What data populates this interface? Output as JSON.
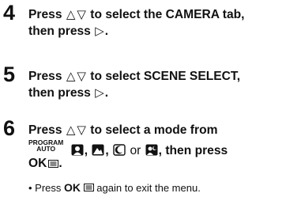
{
  "step4": {
    "number": "4",
    "line1_a": "Press",
    "line1_b": "to select the CAMERA tab,",
    "line2_a": "then press",
    "line2_b": "."
  },
  "step5": {
    "number": "5",
    "line1_a": "Press",
    "line1_b": "to select SCENE SELECT,",
    "line2_a": "then press",
    "line2_b": "."
  },
  "step6": {
    "number": "6",
    "line1_a": "Press",
    "line1_b": "to select a mode from",
    "program_top": "PROGRAM",
    "program_bottom": "AUTO",
    "sep1": ",",
    "sep2": ",",
    "sep3": ",",
    "or": "or",
    "then_press": ", then press",
    "ok": "OK",
    "end": "."
  },
  "note": {
    "bullet": "• Press",
    "ok": "OK",
    "text": "again to exit the menu."
  },
  "glyphs": {
    "up": "△",
    "down": "▽",
    "right": "▷"
  },
  "icons": [
    "portrait-icon",
    "landscape-icon",
    "night-scene-icon",
    "portrait-night-icon",
    "menu-icon"
  ]
}
